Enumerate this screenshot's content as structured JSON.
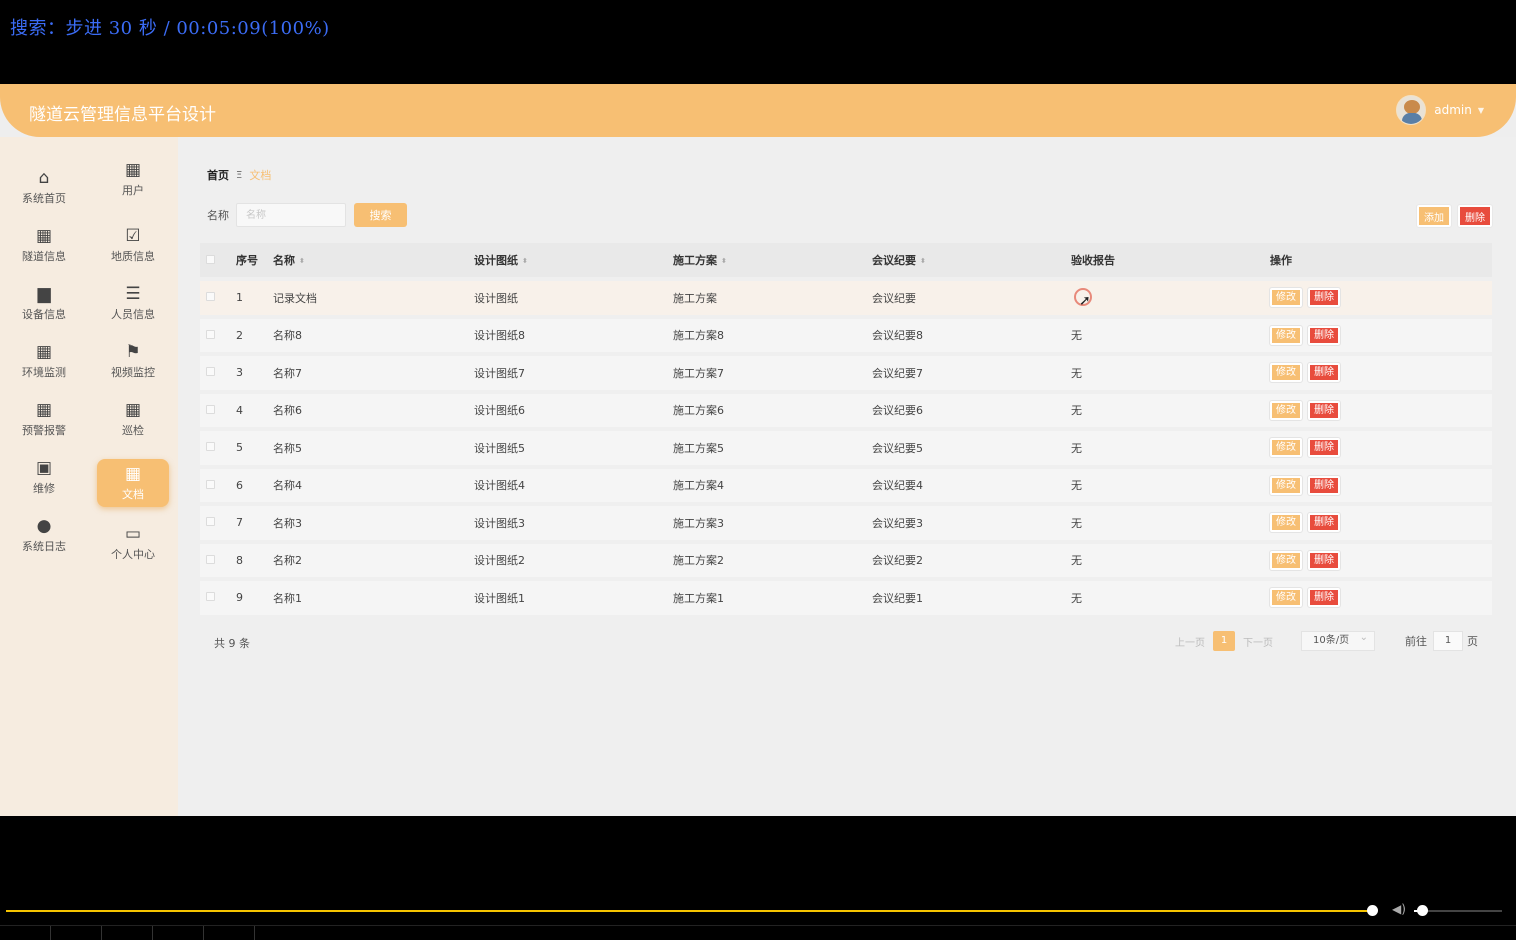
{
  "osd": {
    "text": "搜索：步进 30 秒 / 00:05:09(100%)"
  },
  "header": {
    "title": "隧道云管理信息平台设计",
    "user": "admin",
    "caret": "▼"
  },
  "sidebar": {
    "items": [
      {
        "label": "系统首页",
        "icon": "home-icon",
        "glyph": "⌂"
      },
      {
        "label": "用户",
        "icon": "grid-icon",
        "glyph": "▦"
      },
      {
        "label": "隧道信息",
        "icon": "grid-icon",
        "glyph": "▦"
      },
      {
        "label": "地质信息",
        "icon": "clipboard-icon",
        "glyph": "☑"
      },
      {
        "label": "设备信息",
        "icon": "device-icon",
        "glyph": "▆"
      },
      {
        "label": "人员信息",
        "icon": "sliders-icon",
        "glyph": "☰"
      },
      {
        "label": "环境监测",
        "icon": "grid-icon",
        "glyph": "▦"
      },
      {
        "label": "视频监控",
        "icon": "flag-icon",
        "glyph": "⚑"
      },
      {
        "label": "预警报警",
        "icon": "grid-icon",
        "glyph": "▦"
      },
      {
        "label": "巡检",
        "icon": "grid-icon",
        "glyph": "▦"
      },
      {
        "label": "维修",
        "icon": "briefcase-icon",
        "glyph": "▣"
      },
      {
        "label": "文档",
        "icon": "grid-icon",
        "glyph": "▦"
      },
      {
        "label": "系统日志",
        "icon": "user-icon",
        "glyph": "●"
      },
      {
        "label": "个人中心",
        "icon": "card-icon",
        "glyph": "▭"
      }
    ]
  },
  "breadcrumb": {
    "home": "首页",
    "separator": "Ξ",
    "current": "文档"
  },
  "search": {
    "label": "名称",
    "placeholder": "名称",
    "button": "搜索"
  },
  "actions": {
    "add": "添加",
    "delete": "删除"
  },
  "table": {
    "headers": {
      "index": "序号",
      "name": "名称",
      "drawing": "设计图纸",
      "plan": "施工方案",
      "minutes": "会议纪要",
      "report": "验收报告",
      "ops": "操作"
    },
    "sort_glyph": "⬍",
    "rows": [
      {
        "index": "1",
        "name": "记录文档",
        "drawing": "设计图纸",
        "plan": "施工方案",
        "minutes": "会议纪要",
        "report": ""
      },
      {
        "index": "2",
        "name": "名称8",
        "drawing": "设计图纸8",
        "plan": "施工方案8",
        "minutes": "会议纪要8",
        "report": "无"
      },
      {
        "index": "3",
        "name": "名称7",
        "drawing": "设计图纸7",
        "plan": "施工方案7",
        "minutes": "会议纪要7",
        "report": "无"
      },
      {
        "index": "4",
        "name": "名称6",
        "drawing": "设计图纸6",
        "plan": "施工方案6",
        "minutes": "会议纪要6",
        "report": "无"
      },
      {
        "index": "5",
        "name": "名称5",
        "drawing": "设计图纸5",
        "plan": "施工方案5",
        "minutes": "会议纪要5",
        "report": "无"
      },
      {
        "index": "6",
        "name": "名称4",
        "drawing": "设计图纸4",
        "plan": "施工方案4",
        "minutes": "会议纪要4",
        "report": "无"
      },
      {
        "index": "7",
        "name": "名称3",
        "drawing": "设计图纸3",
        "plan": "施工方案3",
        "minutes": "会议纪要3",
        "report": "无"
      },
      {
        "index": "8",
        "name": "名称2",
        "drawing": "设计图纸2",
        "plan": "施工方案2",
        "minutes": "会议纪要2",
        "report": "无"
      },
      {
        "index": "9",
        "name": "名称1",
        "drawing": "设计图纸1",
        "plan": "施工方案1",
        "minutes": "会议纪要1",
        "report": "无"
      }
    ],
    "edit_label": "修改",
    "delete_label": "删除"
  },
  "pagination": {
    "total": "共 9 条",
    "prev": "上一页",
    "current": "1",
    "next": "下一页",
    "page_size": "10条/页",
    "goto_prefix": "前往",
    "goto_value": "1",
    "goto_suffix": "页"
  },
  "player": {
    "progress": 0.9,
    "volume": 0.09
  },
  "colors": {
    "accent": "#f7bf73",
    "danger": "#e84c3d",
    "osd": "#3b6cf5"
  }
}
